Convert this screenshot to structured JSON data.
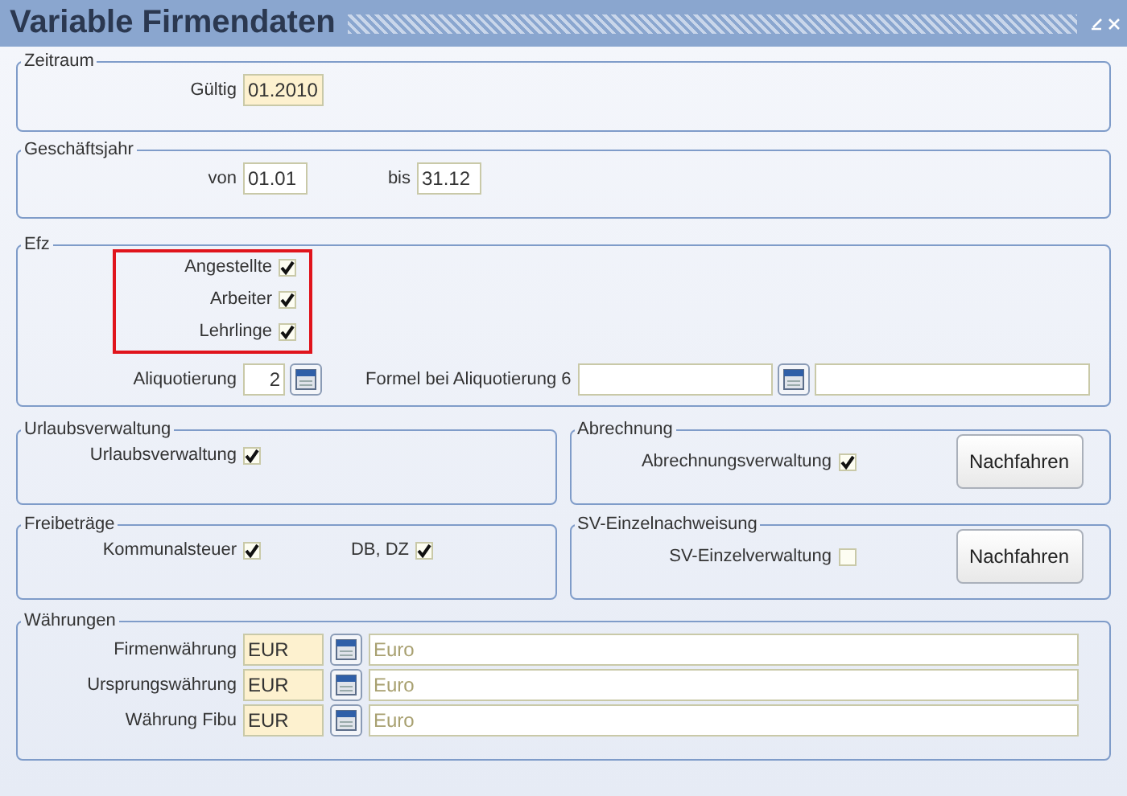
{
  "window": {
    "title": "Variable Firmendaten"
  },
  "zeitraum": {
    "legend": "Zeitraum",
    "gueltig": {
      "label": "Gültig",
      "value": "01.2010",
      "required": true
    }
  },
  "geschaeftsjahr": {
    "legend": "Geschäftsjahr",
    "von": {
      "label": "von",
      "value": "01.01",
      "required": false
    },
    "bis": {
      "label": "bis",
      "value": "31.12",
      "required": false
    }
  },
  "efz": {
    "legend": "Efz",
    "highlighted": true,
    "checkboxes": [
      {
        "label": "Angestellte",
        "checked": true
      },
      {
        "label": "Arbeiter",
        "checked": true
      },
      {
        "label": "Lehrlinge",
        "checked": true
      }
    ],
    "aliquotierung": {
      "label": "Aliquotierung",
      "value": "2",
      "required": false
    },
    "formel": {
      "label": "Formel bei Aliquotierung 6"
    }
  },
  "urlaubsverwaltung": {
    "legend": "Urlaubsverwaltung",
    "checkbox": {
      "label": "Urlaubsverwaltung",
      "checked": true
    }
  },
  "abrechnung": {
    "legend": "Abrechnung",
    "checkbox": {
      "label": "Abrechnungsverwaltung",
      "checked": true
    },
    "button": "Nachfahren"
  },
  "freibetraege": {
    "legend": "Freibeträge",
    "checkboxes": [
      {
        "label": "Kommunalsteuer",
        "checked": true
      },
      {
        "label": "DB, DZ",
        "checked": true
      }
    ]
  },
  "sv_einzelnachweisung": {
    "legend": "SV-Einzelnachweisung",
    "checkbox": {
      "label": "SV-Einzelverwaltung",
      "checked": false
    },
    "button": "Nachfahren"
  },
  "waehrungen": {
    "legend": "Währungen",
    "rows": [
      {
        "label": "Firmenwährung",
        "code": "EUR",
        "name": "Euro",
        "required": true
      },
      {
        "label": "Ursprungswährung",
        "code": "EUR",
        "name": "Euro",
        "required": true
      },
      {
        "label": "Währung Fibu",
        "code": "EUR",
        "name": "Euro",
        "required": true
      }
    ]
  }
}
